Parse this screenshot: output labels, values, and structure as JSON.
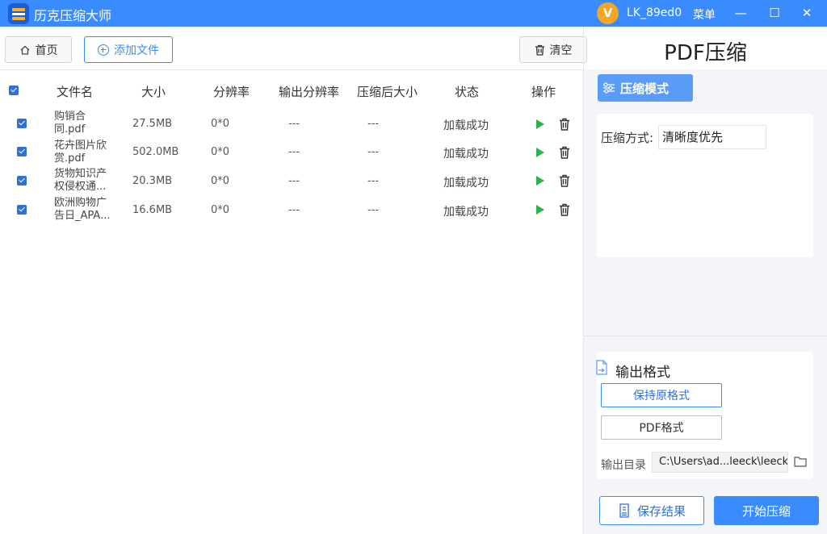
{
  "window": {
    "app_title": "历克压缩大师",
    "vip_badge": "V",
    "username": "LK_89ed0",
    "menu_label": "菜单",
    "minimize_glyph": "—",
    "maximize_glyph": "☐",
    "close_glyph": "✕"
  },
  "toolbar": {
    "home_label": "首页",
    "add_file_label": "添加文件",
    "clear_label": "清空"
  },
  "table": {
    "headers": [
      "文件名",
      "大小",
      "分辨率",
      "输出分辨率",
      "压缩后大小",
      "状态",
      "操作"
    ],
    "rows": [
      {
        "checked": true,
        "name": "购销合\n同.pdf",
        "size": "27.5MB",
        "resolution": "0*0",
        "output_resolution": "---",
        "compressed_size": "---",
        "status": "加载成功"
      },
      {
        "checked": true,
        "name": "花卉图片欣\n赏.pdf",
        "size": "502.0MB",
        "resolution": "0*0",
        "output_resolution": "---",
        "compressed_size": "---",
        "status": "加载成功"
      },
      {
        "checked": true,
        "name": "货物知识产\n权侵权通...",
        "size": "20.3MB",
        "resolution": "0*0",
        "output_resolution": "---",
        "compressed_size": "---",
        "status": "加载成功"
      },
      {
        "checked": true,
        "name": "欧洲购物广\n告日_APA...",
        "size": "16.6MB",
        "resolution": "0*0",
        "output_resolution": "---",
        "compressed_size": "---",
        "status": "加载成功"
      }
    ]
  },
  "right_panel": {
    "title": "PDF压缩",
    "mode_tab_label": "压缩模式",
    "method_label": "压缩方式:",
    "method_value": "清晰度优先",
    "output_format_title": "输出格式",
    "format_keep_label": "保持原格式",
    "format_pdf_label": "PDF格式",
    "output_dir_label": "输出目录",
    "output_dir_path": "C:\\Users\\ad...leeck\\leeck",
    "save_results_label": "保存结果",
    "start_label": "开始压缩"
  },
  "colors": {
    "accent": "#3a8bfd",
    "play_green": "#2fb24c",
    "vip_orange": "#f5a623"
  },
  "icons": [
    "app-logo-icon",
    "home-icon",
    "plus-circle-icon",
    "trash-icon",
    "play-icon",
    "settings-sliders-icon",
    "document-icon",
    "folder-icon",
    "save-icon"
  ]
}
